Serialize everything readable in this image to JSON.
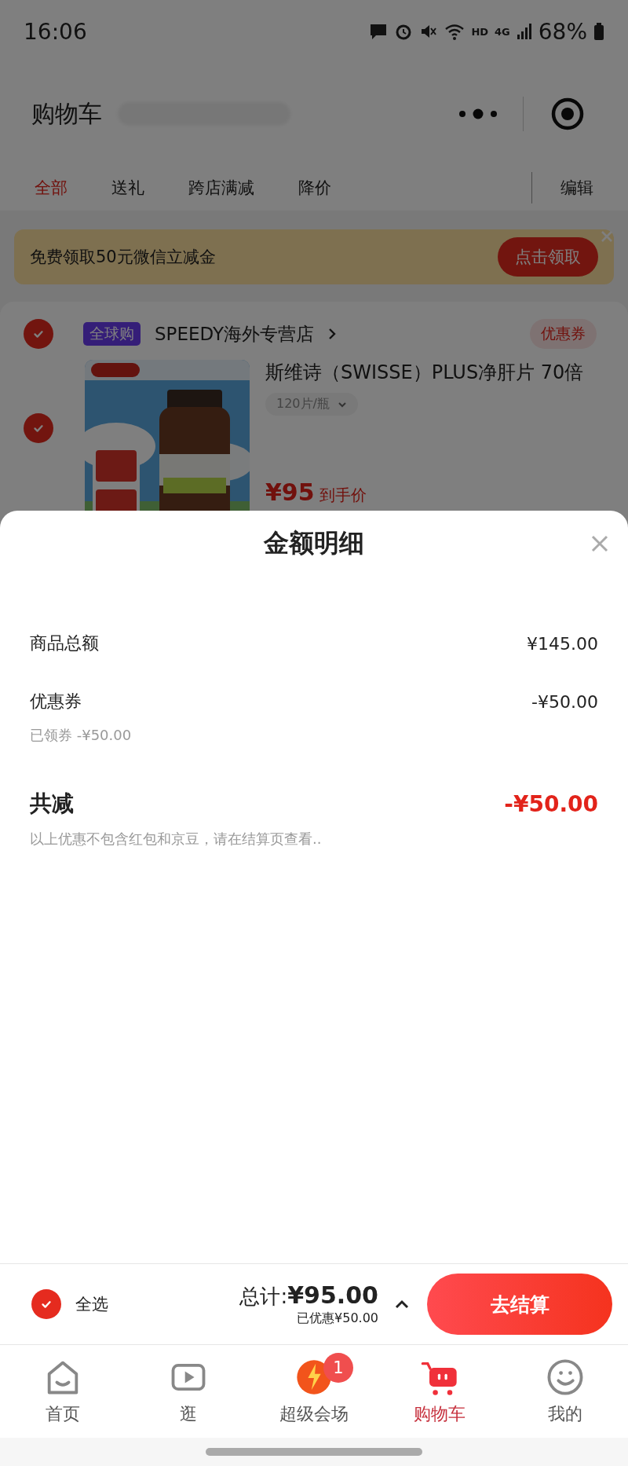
{
  "status_bar": {
    "time": "16:06",
    "hd": "HD",
    "network": "4G",
    "battery": "68%"
  },
  "header": {
    "title": "购物车"
  },
  "tabs": [
    {
      "label": "全部",
      "selected": true
    },
    {
      "label": "送礼",
      "selected": false
    },
    {
      "label": "跨店满减",
      "selected": false
    },
    {
      "label": "降价",
      "selected": false
    }
  ],
  "edit": "编辑",
  "banner": {
    "text": "免费领取50元微信立减金",
    "button": "点击领取"
  },
  "store": {
    "checked": true,
    "badge": "全球购",
    "name": "SPEEDY海外专营店",
    "coupon": "优惠券"
  },
  "item": {
    "checked": true,
    "title": "斯维诗（SWISSE）PLUS净肝片 70倍",
    "spec": "120片/瓶",
    "price": "¥95",
    "price_label": "到手价"
  },
  "sheet": {
    "title": "金额明细",
    "rows": [
      {
        "label": "商品总额",
        "value": "¥145.00"
      },
      {
        "label": "优惠券",
        "value": "-¥50.00",
        "sub": "已领券 -¥50.00"
      }
    ],
    "total": {
      "label": "共减",
      "value": "-¥50.00"
    },
    "note": "以上优惠不包含红包和京豆，请在结算页查看.."
  },
  "checkout": {
    "select_all": {
      "label": "全选",
      "checked": true
    },
    "total_label": "总计:",
    "total": "¥95.00",
    "saved": "已优惠¥50.00",
    "button": "去结算"
  },
  "nav": [
    {
      "label": "首页",
      "selected": false
    },
    {
      "label": "逛",
      "selected": false
    },
    {
      "label": "超级会场",
      "selected": false,
      "badge": "1"
    },
    {
      "label": "购物车",
      "selected": true
    },
    {
      "label": "我的",
      "selected": false
    }
  ]
}
